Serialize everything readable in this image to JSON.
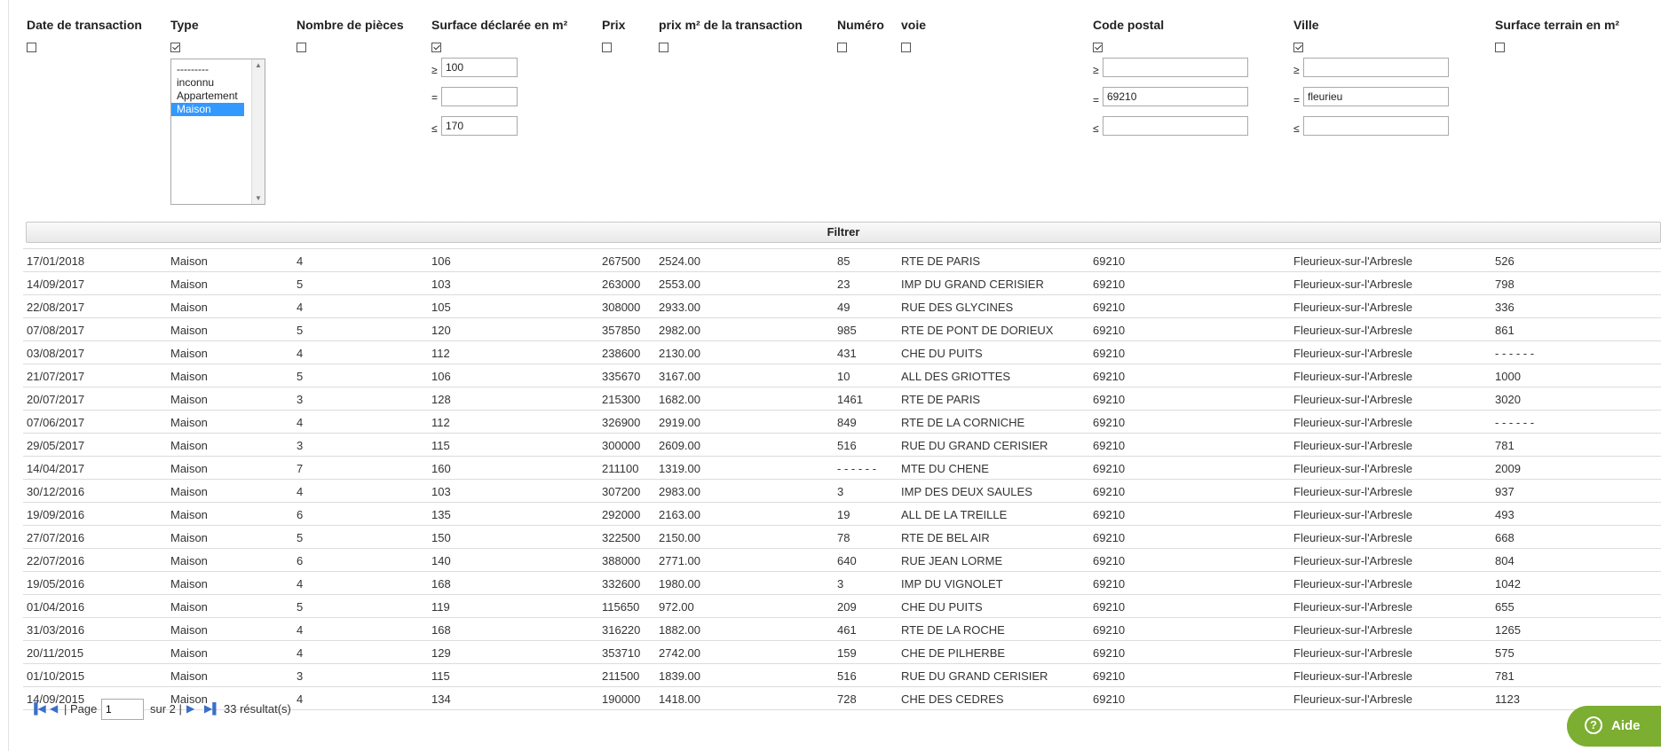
{
  "filters": {
    "headers": [
      "Date de transaction",
      "Type",
      "Nombre de pièces",
      "Surface déclarée en m²",
      "Prix",
      "prix m² de la transaction",
      "Numéro",
      "voie",
      "Code postal",
      "Ville",
      "Surface terrain en m²"
    ],
    "checkboxes": [
      false,
      true,
      false,
      true,
      false,
      false,
      false,
      false,
      true,
      true,
      false
    ],
    "type_options": [
      "---------",
      "inconnu",
      "Appartement",
      "Maison"
    ],
    "type_selected": "Maison",
    "ops": {
      "gte": "≥",
      "eq": "=",
      "lte": "≤"
    },
    "surface": {
      "gte": "100",
      "eq": "",
      "lte": "170"
    },
    "code_postal": {
      "gte": "",
      "eq": "69210",
      "lte": ""
    },
    "ville": {
      "gte": "",
      "eq": "fleurieu",
      "lte": ""
    },
    "filter_label": "Filtrer"
  },
  "table": {
    "rows": [
      [
        "17/01/2018",
        "Maison",
        "4",
        "106",
        "267500",
        "2524.00",
        "85",
        "RTE DE PARIS",
        "69210",
        "Fleurieux-sur-l'Arbresle",
        "526"
      ],
      [
        "14/09/2017",
        "Maison",
        "5",
        "103",
        "263000",
        "2553.00",
        "23",
        "IMP DU GRAND CERISIER",
        "69210",
        "Fleurieux-sur-l'Arbresle",
        "798"
      ],
      [
        "22/08/2017",
        "Maison",
        "4",
        "105",
        "308000",
        "2933.00",
        "49",
        "RUE DES GLYCINES",
        "69210",
        "Fleurieux-sur-l'Arbresle",
        "336"
      ],
      [
        "07/08/2017",
        "Maison",
        "5",
        "120",
        "357850",
        "2982.00",
        "985",
        "RTE DE PONT DE DORIEUX",
        "69210",
        "Fleurieux-sur-l'Arbresle",
        "861"
      ],
      [
        "03/08/2017",
        "Maison",
        "4",
        "112",
        "238600",
        "2130.00",
        "431",
        "CHE DU PUITS",
        "69210",
        "Fleurieux-sur-l'Arbresle",
        "- - - - - -"
      ],
      [
        "21/07/2017",
        "Maison",
        "5",
        "106",
        "335670",
        "3167.00",
        "10",
        "ALL DES GRIOTTES",
        "69210",
        "Fleurieux-sur-l'Arbresle",
        "1000"
      ],
      [
        "20/07/2017",
        "Maison",
        "3",
        "128",
        "215300",
        "1682.00",
        "1461",
        "RTE DE PARIS",
        "69210",
        "Fleurieux-sur-l'Arbresle",
        "3020"
      ],
      [
        "07/06/2017",
        "Maison",
        "4",
        "112",
        "326900",
        "2919.00",
        "849",
        "RTE DE LA CORNICHE",
        "69210",
        "Fleurieux-sur-l'Arbresle",
        "- - - - - -"
      ],
      [
        "29/05/2017",
        "Maison",
        "3",
        "115",
        "300000",
        "2609.00",
        "516",
        "RUE DU GRAND CERISIER",
        "69210",
        "Fleurieux-sur-l'Arbresle",
        "781"
      ],
      [
        "14/04/2017",
        "Maison",
        "7",
        "160",
        "211100",
        "1319.00",
        "- - - - - -",
        "MTE DU CHENE",
        "69210",
        "Fleurieux-sur-l'Arbresle",
        "2009"
      ],
      [
        "30/12/2016",
        "Maison",
        "4",
        "103",
        "307200",
        "2983.00",
        "3",
        "IMP DES DEUX SAULES",
        "69210",
        "Fleurieux-sur-l'Arbresle",
        "937"
      ],
      [
        "19/09/2016",
        "Maison",
        "6",
        "135",
        "292000",
        "2163.00",
        "19",
        "ALL DE LA TREILLE",
        "69210",
        "Fleurieux-sur-l'Arbresle",
        "493"
      ],
      [
        "27/07/2016",
        "Maison",
        "5",
        "150",
        "322500",
        "2150.00",
        "78",
        "RTE DE BEL AIR",
        "69210",
        "Fleurieux-sur-l'Arbresle",
        "668"
      ],
      [
        "22/07/2016",
        "Maison",
        "6",
        "140",
        "388000",
        "2771.00",
        "640",
        "RUE JEAN LORME",
        "69210",
        "Fleurieux-sur-l'Arbresle",
        "804"
      ],
      [
        "19/05/2016",
        "Maison",
        "4",
        "168",
        "332600",
        "1980.00",
        "3",
        "IMP DU VIGNOLET",
        "69210",
        "Fleurieux-sur-l'Arbresle",
        "1042"
      ],
      [
        "01/04/2016",
        "Maison",
        "5",
        "119",
        "115650",
        "972.00",
        "209",
        "CHE DU PUITS",
        "69210",
        "Fleurieux-sur-l'Arbresle",
        "655"
      ],
      [
        "31/03/2016",
        "Maison",
        "4",
        "168",
        "316220",
        "1882.00",
        "461",
        "RTE DE LA ROCHE",
        "69210",
        "Fleurieux-sur-l'Arbresle",
        "1265"
      ],
      [
        "20/11/2015",
        "Maison",
        "4",
        "129",
        "353710",
        "2742.00",
        "159",
        "CHE DE PILHERBE",
        "69210",
        "Fleurieux-sur-l'Arbresle",
        "575"
      ],
      [
        "01/10/2015",
        "Maison",
        "3",
        "115",
        "211500",
        "1839.00",
        "516",
        "RUE DU GRAND CERISIER",
        "69210",
        "Fleurieux-sur-l'Arbresle",
        "781"
      ],
      [
        "14/09/2015",
        "Maison",
        "4",
        "134",
        "190000",
        "1418.00",
        "728",
        "CHE DES CEDRES",
        "69210",
        "Fleurieux-sur-l'Arbresle",
        "1123"
      ]
    ]
  },
  "pager": {
    "page_label": "| Page",
    "page_value": "1",
    "of_label": "sur 2 |",
    "results": "33 résultat(s)"
  },
  "help": {
    "label": "Aide"
  },
  "colors": {
    "accent": "#3399ff",
    "help_bg": "#7cae31",
    "pager_icon": "#3a6fc7"
  }
}
